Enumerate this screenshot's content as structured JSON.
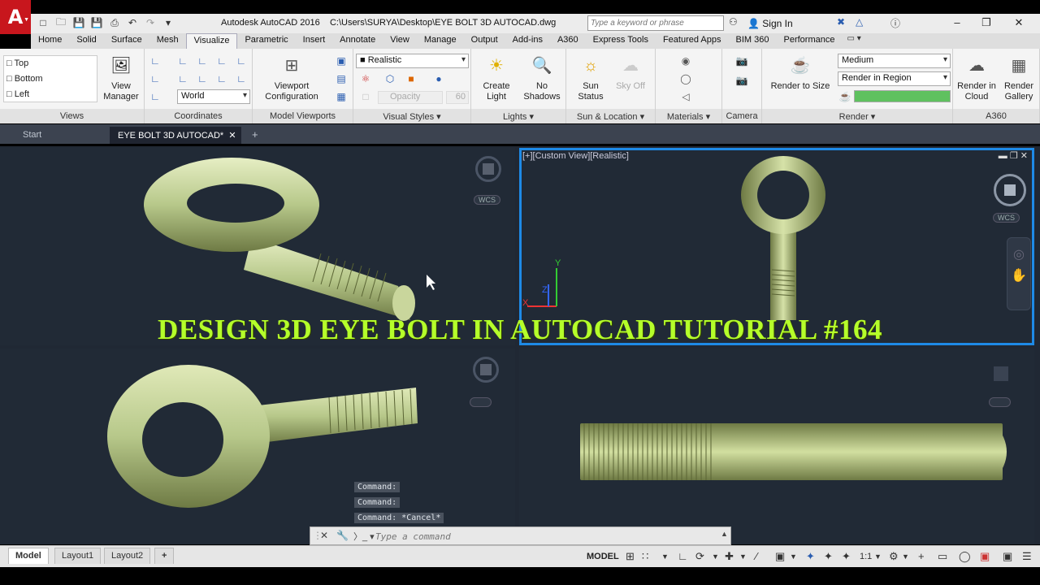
{
  "window": {
    "app_title": "Autodesk AutoCAD 2016",
    "file_path": "C:\\Users\\SURYA\\Desktop\\EYE BOLT 3D AUTOCAD.dwg",
    "search_placeholder": "Type a keyword or phrase",
    "signin": "Sign In"
  },
  "ribbon_tabs": [
    "Home",
    "Solid",
    "Surface",
    "Mesh",
    "Visualize",
    "Parametric",
    "Insert",
    "Annotate",
    "View",
    "Manage",
    "Output",
    "Add-ins",
    "A360",
    "Express Tools",
    "Featured Apps",
    "BIM 360",
    "Performance"
  ],
  "active_tab": "Visualize",
  "panels": {
    "views": {
      "title": "Views",
      "items": [
        "Top",
        "Bottom",
        "Left"
      ],
      "view_manager": "View Manager"
    },
    "coordinates": {
      "title": "Coordinates",
      "ucs": "World"
    },
    "model_viewports": {
      "title": "Model Viewports",
      "config": "Viewport Configuration"
    },
    "visual_styles": {
      "title": "Visual Styles",
      "style": "Realistic",
      "opacity_label": "Opacity",
      "opacity_value": "60"
    },
    "lights": {
      "title": "Lights",
      "create": "Create Light",
      "shadows": "No Shadows"
    },
    "sun": {
      "title": "Sun & Location",
      "status": "Sun Status",
      "sky": "Sky Off"
    },
    "materials": {
      "title": "Materials"
    },
    "camera": {
      "title": "Camera"
    },
    "render": {
      "title": "Render",
      "render_to_size": "Render to Size",
      "quality": "Medium",
      "region": "Render in Region"
    },
    "a360": {
      "title": "A360",
      "cloud": "Render in Cloud",
      "gallery": "Render Gallery"
    }
  },
  "doc_tabs": {
    "start": "Start",
    "active": "EYE BOLT 3D AUTOCAD*"
  },
  "viewports": {
    "active_label": "[+][Custom View][Realistic]",
    "wcs": "WCS"
  },
  "banner": "DESIGN 3D EYE BOLT IN AUTOCAD TUTORIAL #164",
  "command_history": [
    "Command:",
    "Command:",
    "Command: *Cancel*"
  ],
  "command_placeholder": "Type a command",
  "status": {
    "layouts": [
      "Model",
      "Layout1",
      "Layout2"
    ],
    "model": "MODEL",
    "scale": "1:1"
  },
  "colors": {
    "bolt": "#b7c88a",
    "accent": "#1e8ae6",
    "banner": "#b5ff2a"
  }
}
